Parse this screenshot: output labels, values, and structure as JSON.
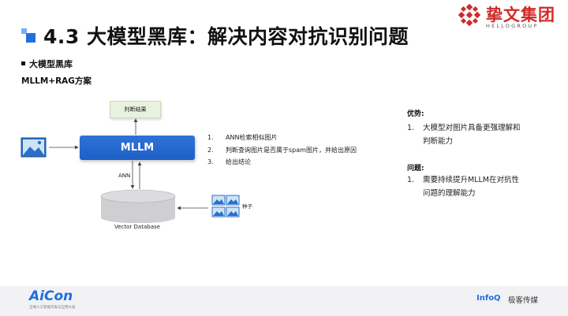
{
  "header": {
    "title": "4.3 大模型黑库：解决内容对抗识别问题",
    "logo_text": "挚文集团",
    "logo_subtext": "HELLOGROUP"
  },
  "intro": {
    "section": "大模型黑库",
    "approach": "MLLM+RAG方案"
  },
  "diagram": {
    "judge_box": "判断结果",
    "mllm_box": "MLLM",
    "ann_label": "ANN",
    "vector_db_label": "Vector Database",
    "seed_label": "种子",
    "steps": [
      {
        "num": "1.",
        "text": "ANN检索相似图片"
      },
      {
        "num": "2.",
        "text": "判断查询图片是否属于spam图片，并给出原因"
      },
      {
        "num": "3.",
        "text": "给出结论"
      }
    ]
  },
  "advantages": {
    "title": "优势:",
    "items": [
      {
        "num": "1.",
        "lines": [
          "大模型对图片具备更强理解和",
          "判断能力"
        ]
      }
    ]
  },
  "problems": {
    "title": "问题:",
    "items": [
      {
        "num": "1.",
        "lines": [
          "需要持续提升MLLM在对抗性",
          "问题的理解能力"
        ]
      }
    ]
  },
  "footer": {
    "event_logo": "AiCon",
    "event_sub": "全球人工智能开发与应用大会",
    "infoq": "InfoQ",
    "media": "极客传媒"
  },
  "colors": {
    "accent_blue": "#1f6fe0",
    "logo_red": "#d12a2a",
    "judge_green": "#e8f2df"
  }
}
